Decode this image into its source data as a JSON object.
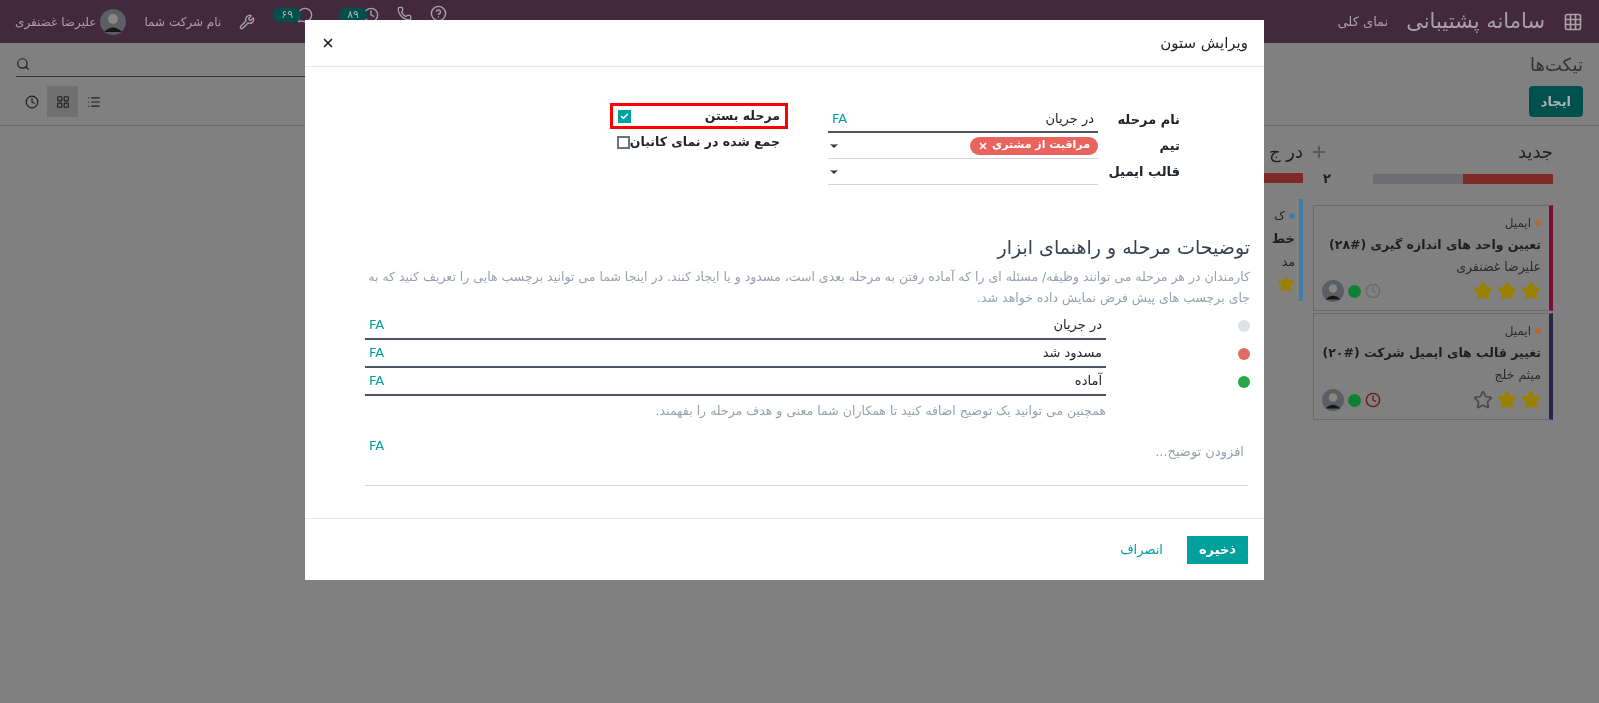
{
  "navbar": {
    "app_title": "سامانه پشتیبانی",
    "menu": [
      {
        "label": "نمای کلی"
      }
    ],
    "activity_count": "۸۹",
    "message_count": "۶۹",
    "company": "نام شرکت شما",
    "user": "علیرضا غضنفری"
  },
  "page": {
    "title": "تیکت‌ها",
    "create_button": "ایجاد",
    "views": [
      {
        "kind": "list",
        "selected": false
      },
      {
        "kind": "kanban",
        "selected": true
      },
      {
        "kind": "activity",
        "selected": false
      }
    ]
  },
  "columns": [
    {
      "title": "جدید",
      "count": "۲",
      "level": 0.5,
      "cards": [
        {
          "tag": {
            "label": "ایمیل",
            "color": "#b06a35"
          },
          "title": "تعیین واحد های اندازه گیری (#۲۸)",
          "assignee": "علیرضا غضنفری",
          "stars": 3,
          "status": {
            "color": "#0e8033"
          },
          "overdue": false,
          "color": "#7a0c32"
        },
        {
          "tag": {
            "label": "ایمیل",
            "color": "#b06a35"
          },
          "title": "تغییر قالب های ایمیل شرکت (#۲۰)",
          "assignee": "میثم خلج",
          "stars": 2,
          "status": {
            "color": "#0e8033"
          },
          "overdue": true,
          "color": "#23284a"
        }
      ]
    }
  ],
  "partial_column": {
    "title": "در ج",
    "level": 1,
    "card": {
      "tag": {
        "label": "ک",
        "color": "#3b7fa8"
      },
      "title": "خط",
      "assignee": "مد",
      "color": "#3b7fa8"
    }
  },
  "dialog": {
    "title": "ویرایش ستون",
    "fields": [
      {
        "label": "نام مرحله",
        "kind": "text",
        "value": "در جریان",
        "lang": "FA"
      },
      {
        "label": "تیم",
        "kind": "tags",
        "tags": [
          "مراقبت از مشتری"
        ]
      },
      {
        "label": "قالب ایمیل",
        "kind": "select"
      }
    ],
    "checkboxes": [
      {
        "label": "مرحله بستن",
        "checked": true,
        "highlighted": true
      },
      {
        "label": "جمع شده در نمای کانبان",
        "checked": false,
        "highlighted": false
      }
    ],
    "section_title": "توضیحات مرحله و راهنمای ابزار",
    "section_help": "کارمندان در هر مرحله می توانند وظیفه/ مسئله ای را که آماده رفتن به مرحله بعدی است، مسدود و یا ایجاد کنند. در اینجا شما می توانید برچسب هایی را تعریف کنید که به جای برچسب های پیش فرض نمایش داده خواهد شد.",
    "legends": [
      {
        "color": "#dee2e6",
        "value": "در جریان",
        "lang": "FA"
      },
      {
        "color": "#e06c66",
        "value": "مسدود شد",
        "lang": "FA"
      },
      {
        "color": "#28a745",
        "value": "آماده",
        "lang": "FA"
      }
    ],
    "description_help": "همچنین می توانید یک توضیح اضافه کنید تا همکاران شما معنی و هدف مرحله را بفهمند.",
    "description": {
      "placeholder": "افزودن توضیح...",
      "lang": "FA"
    },
    "buttons": [
      {
        "label": "ذخیره",
        "kind": "primary"
      },
      {
        "label": "انصراف",
        "kind": "secondary"
      }
    ]
  }
}
